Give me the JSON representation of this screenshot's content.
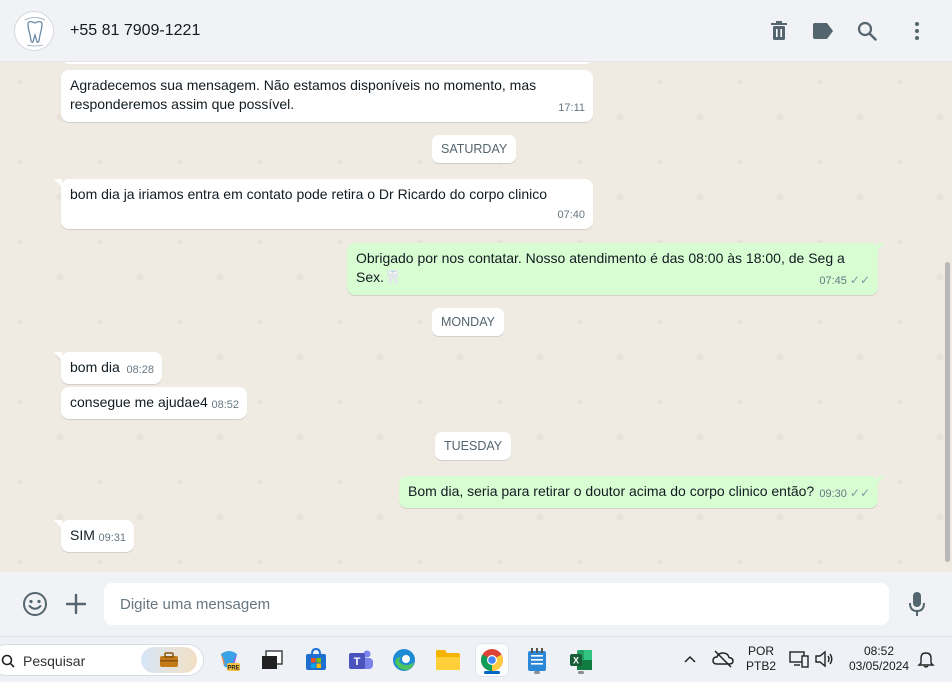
{
  "header": {
    "contact_name": "+55 81 7909-1221"
  },
  "messages": [
    {
      "direction": "in",
      "text": "Agradecemos sua mensagem. Não estamos disponíveis no momento, mas responderemos assim que possível.",
      "time": "17:11"
    },
    {
      "day": "SATURDAY"
    },
    {
      "direction": "in",
      "text": "bom dia ja iriamos entra em contato pode retira o Dr Ricardo do corpo clinico",
      "time": "07:40"
    },
    {
      "direction": "out",
      "text": "Obrigado por nos contatar. Nosso atendimento é das 08:00 às 18:00, de Seg a Sex.🦷",
      "time": "07:45",
      "status": "read"
    },
    {
      "day": "MONDAY"
    },
    {
      "direction": "in",
      "text": "bom dia",
      "time": "08:28"
    },
    {
      "direction": "in",
      "text": "consegue me ajudae4",
      "time": "08:52"
    },
    {
      "day": "TUESDAY"
    },
    {
      "direction": "out",
      "text": "Bom dia, seria para retirar o doutor acima do corpo clinico então?",
      "time": "09:30",
      "status": "read"
    },
    {
      "direction": "in",
      "text": "SIM",
      "time": "09:31"
    }
  ],
  "compose": {
    "placeholder": "Digite uma mensagem"
  },
  "taskbar": {
    "search_label": "Pesquisar",
    "apps": [
      "briefcase",
      "copilot",
      "task-view",
      "microsoft-store",
      "teams",
      "edge",
      "file-explorer",
      "chrome",
      "notepad",
      "excel"
    ],
    "active_app": "chrome",
    "language_line1": "POR",
    "language_line2": "PTB2",
    "time": "08:52",
    "date": "03/05/2024"
  },
  "colors": {
    "incoming_bubble": "#ffffff",
    "outgoing_bubble": "#d9fdd3",
    "chat_background": "#efeae2",
    "header_background": "#f0f2f5",
    "read_tick": "#8696a0"
  }
}
